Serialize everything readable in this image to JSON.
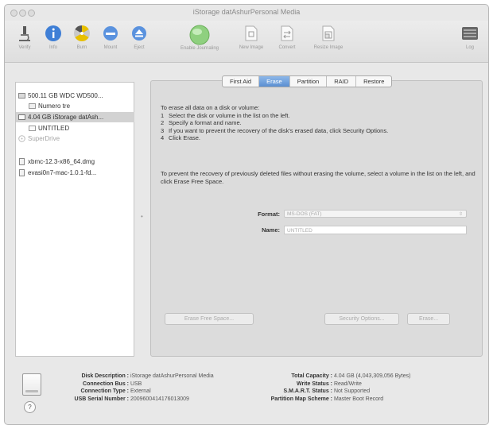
{
  "window": {
    "title": "iStorage datAshurPersonal Media"
  },
  "toolbar": {
    "items": [
      {
        "label": "Verify",
        "icon": "microscope-icon"
      },
      {
        "label": "Info",
        "icon": "info-icon"
      },
      {
        "label": "Burn",
        "icon": "burn-icon"
      },
      {
        "label": "Mount",
        "icon": "mount-icon"
      },
      {
        "label": "Eject",
        "icon": "eject-icon"
      },
      {
        "label": "Enable Journaling",
        "icon": "journaling-icon"
      },
      {
        "label": "New Image",
        "icon": "new-image-icon"
      },
      {
        "label": "Convert",
        "icon": "convert-icon"
      },
      {
        "label": "Resize Image",
        "icon": "resize-image-icon"
      },
      {
        "label": "Log",
        "icon": "log-icon"
      }
    ]
  },
  "sidebar": {
    "items": [
      {
        "label": "500.11 GB WDC WD500...",
        "icon": "hard-disk-icon",
        "selected": false,
        "disabled": false
      },
      {
        "label": "Numero tre",
        "icon": "volume-icon",
        "selected": false,
        "disabled": false
      },
      {
        "label": "4.04 GB iStorage datAsh...",
        "icon": "usb-disk-icon",
        "selected": true,
        "disabled": false
      },
      {
        "label": "UNTITLED",
        "icon": "volume-icon",
        "selected": false,
        "disabled": false
      },
      {
        "label": "SuperDrive",
        "icon": "optical-drive-icon",
        "selected": false,
        "disabled": true
      },
      {
        "label": "xbmc-12.3-x86_64.dmg",
        "icon": "disk-image-icon",
        "selected": false,
        "disabled": false
      },
      {
        "label": "evasi0n7-mac-1.0.1-fd...",
        "icon": "disk-image-icon",
        "selected": false,
        "disabled": false
      }
    ]
  },
  "tabs": [
    {
      "label": "First Aid",
      "selected": false
    },
    {
      "label": "Erase",
      "selected": true
    },
    {
      "label": "Partition",
      "selected": false
    },
    {
      "label": "RAID",
      "selected": false
    },
    {
      "label": "Restore",
      "selected": false
    }
  ],
  "erase": {
    "intro": "To erase all data on a disk or volume:",
    "steps": [
      {
        "num": "1",
        "text": "Select the disk or volume in the list on the left."
      },
      {
        "num": "2",
        "text": "Specify a format and name."
      },
      {
        "num": "3",
        "text": "If you want to prevent the recovery of the disk's erased data, click Security Options."
      },
      {
        "num": "4",
        "text": "Click Erase."
      }
    ],
    "note": "To prevent the recovery of previously deleted files without erasing the volume, select a volume in the list on the left, and click Erase Free Space.",
    "format_label": "Format:",
    "format_value": "MS-DOS (FAT)",
    "name_label": "Name:",
    "name_value": "UNTITLED",
    "erase_free_space": "Erase Free Space...",
    "security_options": "Security Options...",
    "erase_button": "Erase..."
  },
  "info": {
    "left": [
      {
        "key": "Disk Description :",
        "value": "iStorage datAshurPersonal Media"
      },
      {
        "key": "Connection Bus :",
        "value": "USB"
      },
      {
        "key": "Connection Type :",
        "value": "External"
      },
      {
        "key": "USB Serial Number :",
        "value": "2009600414176013009"
      }
    ],
    "right": [
      {
        "key": "Total Capacity :",
        "value": "4.04 GB (4,043,309,056 Bytes)"
      },
      {
        "key": "Write Status :",
        "value": "Read/Write"
      },
      {
        "key": "S.M.A.R.T. Status :",
        "value": "Not Supported"
      },
      {
        "key": "Partition Map Scheme :",
        "value": "Master Boot Record"
      }
    ],
    "help": "?"
  }
}
